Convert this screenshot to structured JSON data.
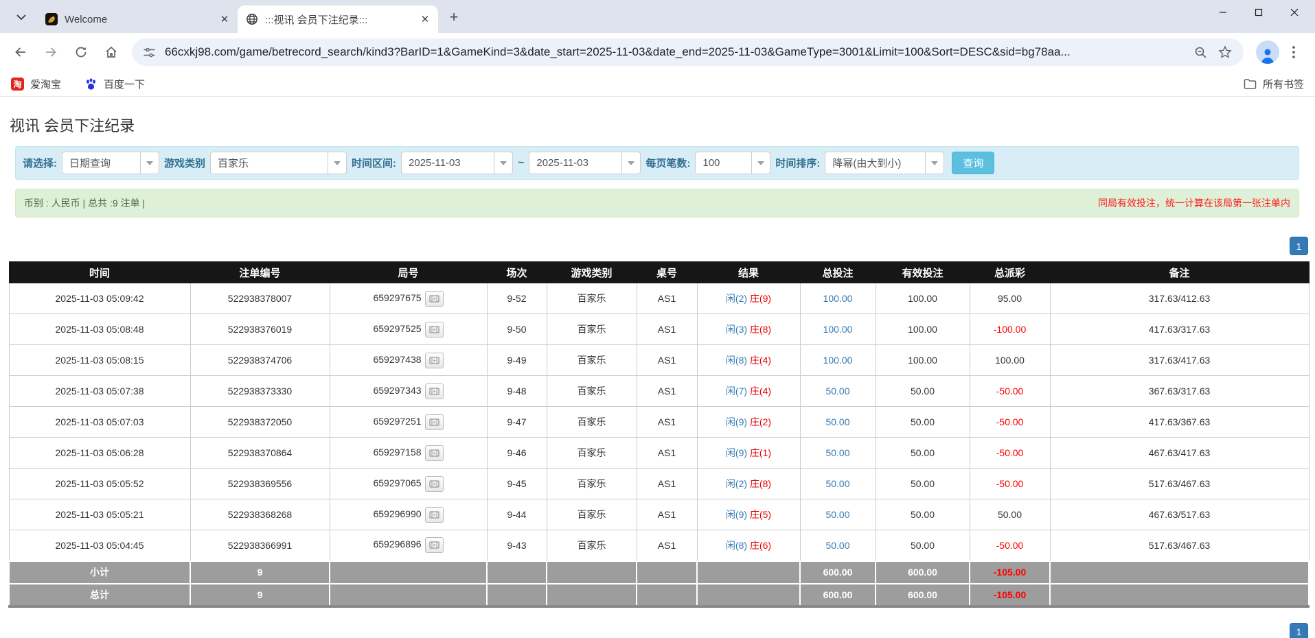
{
  "browser": {
    "tabs": [
      {
        "title": "Welcome"
      },
      {
        "title": ":::视讯 会员下注纪录:::"
      }
    ],
    "url": "66cxkj98.com/game/betrecord_search/kind3?BarID=1&GameKind=3&date_start=2025-11-03&date_end=2025-11-03&GameType=3001&Limit=100&Sort=DESC&sid=bg78aa...",
    "bookmarks": [
      {
        "label": "爱淘宝"
      },
      {
        "label": "百度一下"
      }
    ],
    "all_bookmarks_label": "所有书签"
  },
  "page": {
    "title": "视讯 会员下注纪录",
    "filters": {
      "select_label": "请选择:",
      "select_value": "日期查询",
      "game_type_label": "游戏类别",
      "game_type_value": "百家乐",
      "date_range_label": "时间区间:",
      "date_start": "2025-11-03",
      "date_separator": "~",
      "date_end": "2025-11-03",
      "page_size_label": "每页笔数:",
      "page_size_value": "100",
      "sort_label": "时间排序:",
      "sort_value": "降幂(由大到小)",
      "search_button": "查询"
    },
    "info_bar": {
      "left": "币别 : 人民币 | 总共 :9 注单 |",
      "right": "同局有效投注，统一计算在该局第一张注单内"
    },
    "pagination_label": "1",
    "table": {
      "headers": [
        "时间",
        "注单编号",
        "局号",
        "场次",
        "游戏类别",
        "桌号",
        "结果",
        "总投注",
        "有效投注",
        "总派彩",
        "备注"
      ],
      "rows": [
        {
          "time": "2025-11-03 05:09:42",
          "bet_id": "522938378007",
          "round_id": "659297675",
          "session": "9-52",
          "game": "百家乐",
          "table_id": "AS1",
          "player": "闲(2)",
          "banker": "庄(9)",
          "total_bet": "100.00",
          "valid_bet": "100.00",
          "payout": "95.00",
          "note": "317.63/412.63"
        },
        {
          "time": "2025-11-03 05:08:48",
          "bet_id": "522938376019",
          "round_id": "659297525",
          "session": "9-50",
          "game": "百家乐",
          "table_id": "AS1",
          "player": "闲(3)",
          "banker": "庄(8)",
          "total_bet": "100.00",
          "valid_bet": "100.00",
          "payout": "-100.00",
          "note": "417.63/317.63"
        },
        {
          "time": "2025-11-03 05:08:15",
          "bet_id": "522938374706",
          "round_id": "659297438",
          "session": "9-49",
          "game": "百家乐",
          "table_id": "AS1",
          "player": "闲(8)",
          "banker": "庄(4)",
          "total_bet": "100.00",
          "valid_bet": "100.00",
          "payout": "100.00",
          "note": "317.63/417.63"
        },
        {
          "time": "2025-11-03 05:07:38",
          "bet_id": "522938373330",
          "round_id": "659297343",
          "session": "9-48",
          "game": "百家乐",
          "table_id": "AS1",
          "player": "闲(7)",
          "banker": "庄(4)",
          "total_bet": "50.00",
          "valid_bet": "50.00",
          "payout": "-50.00",
          "note": "367.63/317.63"
        },
        {
          "time": "2025-11-03 05:07:03",
          "bet_id": "522938372050",
          "round_id": "659297251",
          "session": "9-47",
          "game": "百家乐",
          "table_id": "AS1",
          "player": "闲(9)",
          "banker": "庄(2)",
          "total_bet": "50.00",
          "valid_bet": "50.00",
          "payout": "-50.00",
          "note": "417.63/367.63"
        },
        {
          "time": "2025-11-03 05:06:28",
          "bet_id": "522938370864",
          "round_id": "659297158",
          "session": "9-46",
          "game": "百家乐",
          "table_id": "AS1",
          "player": "闲(9)",
          "banker": "庄(1)",
          "total_bet": "50.00",
          "valid_bet": "50.00",
          "payout": "-50.00",
          "note": "467.63/417.63"
        },
        {
          "time": "2025-11-03 05:05:52",
          "bet_id": "522938369556",
          "round_id": "659297065",
          "session": "9-45",
          "game": "百家乐",
          "table_id": "AS1",
          "player": "闲(2)",
          "banker": "庄(8)",
          "total_bet": "50.00",
          "valid_bet": "50.00",
          "payout": "-50.00",
          "note": "517.63/467.63"
        },
        {
          "time": "2025-11-03 05:05:21",
          "bet_id": "522938368268",
          "round_id": "659296990",
          "session": "9-44",
          "game": "百家乐",
          "table_id": "AS1",
          "player": "闲(9)",
          "banker": "庄(5)",
          "total_bet": "50.00",
          "valid_bet": "50.00",
          "payout": "50.00",
          "note": "467.63/517.63"
        },
        {
          "time": "2025-11-03 05:04:45",
          "bet_id": "522938366991",
          "round_id": "659296896",
          "session": "9-43",
          "game": "百家乐",
          "table_id": "AS1",
          "player": "闲(8)",
          "banker": "庄(6)",
          "total_bet": "50.00",
          "valid_bet": "50.00",
          "payout": "-50.00",
          "note": "517.63/467.63"
        }
      ],
      "footer": [
        {
          "label": "小计",
          "count": "9",
          "total_bet": "600.00",
          "valid_bet": "600.00",
          "payout": "-105.00"
        },
        {
          "label": "总计",
          "count": "9",
          "total_bet": "600.00",
          "valid_bet": "600.00",
          "payout": "-105.00"
        }
      ]
    }
  },
  "colors": {
    "accent_blue": "#337ab7",
    "player_blue": "#337ab7",
    "banker_red": "#e60000",
    "negative_red": "#ff0000",
    "filter_panel_bg": "#d9edf7",
    "info_bar_bg": "#dff0d8",
    "search_button_bg": "#5bc0de",
    "table_header_bg": "#161616",
    "table_footer_bg": "#9d9d9d"
  }
}
